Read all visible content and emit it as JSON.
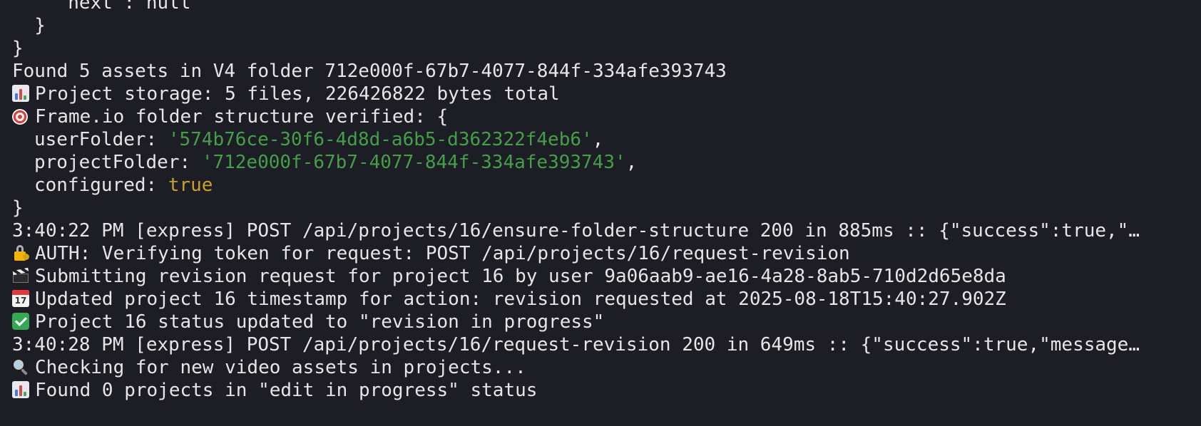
{
  "terminal": {
    "lines": {
      "l0": "    \"next\": null",
      "l1": "  }",
      "l2": "}",
      "l3": "Found 5 assets in V4 folder 712e000f-67b7-4077-844f-334afe393743",
      "l4": "Project storage: 5 files, 226426822 bytes total",
      "l5": "Frame.io folder structure verified: {",
      "l6_key": "userFolder: ",
      "l6_val": "'574b76ce-30f6-4d8d-a6b5-d362322f4eb6'",
      "l6_tail": ",",
      "l7_key": "projectFolder: ",
      "l7_val": "'712e000f-67b7-4077-844f-334afe393743'",
      "l7_tail": ",",
      "l8_key": "configured: ",
      "l8_val": "true",
      "l9": "}",
      "l10": "3:40:22 PM [express] POST /api/projects/16/ensure-folder-structure 200 in 885ms :: {\"success\":true,\"…",
      "l11": "AUTH: Verifying token for request: POST /api/projects/16/request-revision",
      "l12": "Submitting revision request for project 16 by user 9a06aab9-ae16-4a28-8ab5-710d2d65e8da",
      "l13": "Updated project 16 timestamp for action: revision requested at 2025-08-18T15:40:27.902Z",
      "l14": "Project 16 status updated to \"revision in progress\"",
      "l15": "3:40:28 PM [express] POST /api/projects/16/request-revision 200 in 649ms :: {\"success\":true,\"message…",
      "l16": "Checking for new video assets in projects...",
      "l17": "Found 0 projects in \"edit in progress\" status"
    },
    "icons": {
      "l4": "bar-chart-icon",
      "l5": "target-icon",
      "l11": "lock-with-key-icon",
      "l12": "clapper-board-icon",
      "l13": "calendar-icon",
      "l13_day": "17",
      "l14": "check-mark-icon",
      "l16": "magnifying-glass-icon",
      "l17": "bar-chart-icon"
    },
    "colors": {
      "background": "#1c1d25",
      "text": "#e6e6e6",
      "string": "#43a047",
      "boolean": "#c9a227"
    }
  }
}
